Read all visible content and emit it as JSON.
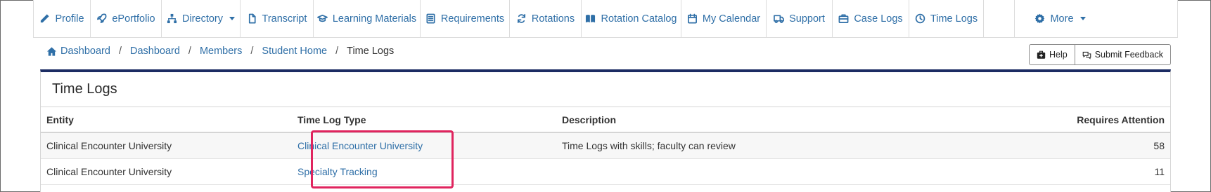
{
  "nav": {
    "items": [
      {
        "label": "Profile",
        "icon": "pencil-icon"
      },
      {
        "label": "ePortfolio",
        "icon": "rocket-icon"
      },
      {
        "label": "Directory",
        "icon": "sitemap-icon",
        "dropdown": true
      },
      {
        "label": "Transcript",
        "icon": "file-icon"
      },
      {
        "label": "Learning Materials",
        "icon": "graduation-cap-icon"
      },
      {
        "label": "Requirements",
        "icon": "list-icon"
      },
      {
        "label": "Rotations",
        "icon": "refresh-icon"
      },
      {
        "label": "Rotation Catalog",
        "icon": "book-icon"
      },
      {
        "label": "My Calendar",
        "icon": "calendar-icon"
      },
      {
        "label": "Support",
        "icon": "truck-icon"
      },
      {
        "label": "Case Logs",
        "icon": "briefcase-icon"
      },
      {
        "label": "Time Logs",
        "icon": "clock-icon"
      },
      {
        "label": "",
        "icon": ""
      },
      {
        "label": "More",
        "icon": "gear-icon",
        "dropdown": true
      }
    ]
  },
  "breadcrumb": {
    "items": [
      "Dashboard",
      "Dashboard",
      "Members",
      "Student Home"
    ],
    "current": "Time Logs",
    "separator": "/"
  },
  "actions": {
    "help_label": "Help",
    "feedback_label": "Submit Feedback"
  },
  "panel": {
    "title": "Time Logs",
    "columns": [
      "Entity",
      "Time Log Type",
      "Description",
      "Requires Attention"
    ],
    "rows": [
      {
        "entity": "Clinical Encounter University",
        "type": "Clinical Encounter University",
        "description": "Time Logs with skills; faculty can review",
        "attention": "58"
      },
      {
        "entity": "Clinical Encounter University",
        "type": "Specialty Tracking",
        "description": "",
        "attention": "11"
      }
    ]
  },
  "colors": {
    "link": "#2f6fa7",
    "panel_accent": "#1c2c63",
    "highlight": "#e0245e"
  }
}
